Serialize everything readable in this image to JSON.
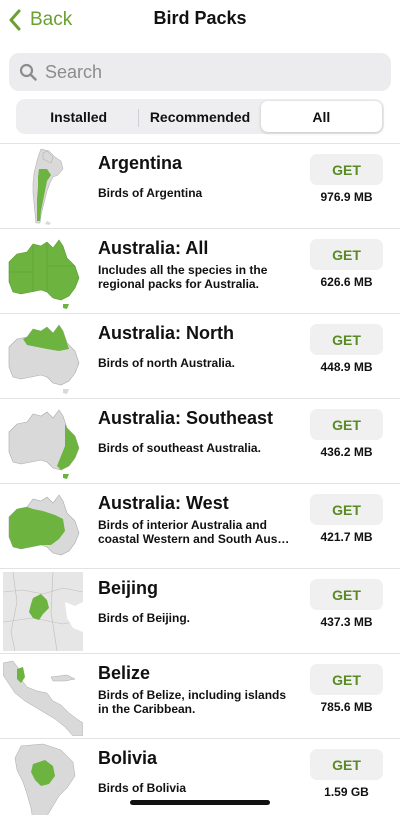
{
  "nav": {
    "back_label": "Back",
    "title": "Bird Packs"
  },
  "search": {
    "placeholder": "Search"
  },
  "segments": {
    "installed": "Installed",
    "recommended": "Recommended",
    "all": "All",
    "selected": "All"
  },
  "colors": {
    "accent": "#6aa02f",
    "get_text": "#5a8a25",
    "map_fill": "#6db33f",
    "map_base": "#d9d9d9"
  },
  "packs": [
    {
      "name": "Argentina",
      "desc1": "Birds of Argentina",
      "desc2": "",
      "button": "GET",
      "size": "976.9 MB",
      "map": "argentina-map"
    },
    {
      "name": "Australia: All",
      "desc1": "Includes all the species in the",
      "desc2": "regional packs for Australia.",
      "button": "GET",
      "size": "626.6 MB",
      "map": "australia-all-map"
    },
    {
      "name": "Australia: North",
      "desc1": "Birds of north Australia.",
      "desc2": "",
      "button": "GET",
      "size": "448.9 MB",
      "map": "australia-north-map"
    },
    {
      "name": "Australia: Southeast",
      "desc1": "Birds of southeast Australia.",
      "desc2": "",
      "button": "GET",
      "size": "436.2 MB",
      "map": "australia-southeast-map"
    },
    {
      "name": "Australia: West",
      "desc1": "Birds of interior Australia and",
      "desc2": "coastal Western and South Aus…",
      "button": "GET",
      "size": "421.7 MB",
      "map": "australia-west-map"
    },
    {
      "name": "Beijing",
      "desc1": "Birds of Beijing.",
      "desc2": "",
      "button": "GET",
      "size": "437.3 MB",
      "map": "beijing-map"
    },
    {
      "name": "Belize",
      "desc1": "Birds of Belize, including islands",
      "desc2": "in the Caribbean.",
      "button": "GET",
      "size": "785.6 MB",
      "map": "belize-map"
    },
    {
      "name": "Bolivia",
      "desc1": "Birds of Bolivia",
      "desc2": "",
      "button": "GET",
      "size": "1.59 GB",
      "map": "bolivia-map"
    }
  ]
}
